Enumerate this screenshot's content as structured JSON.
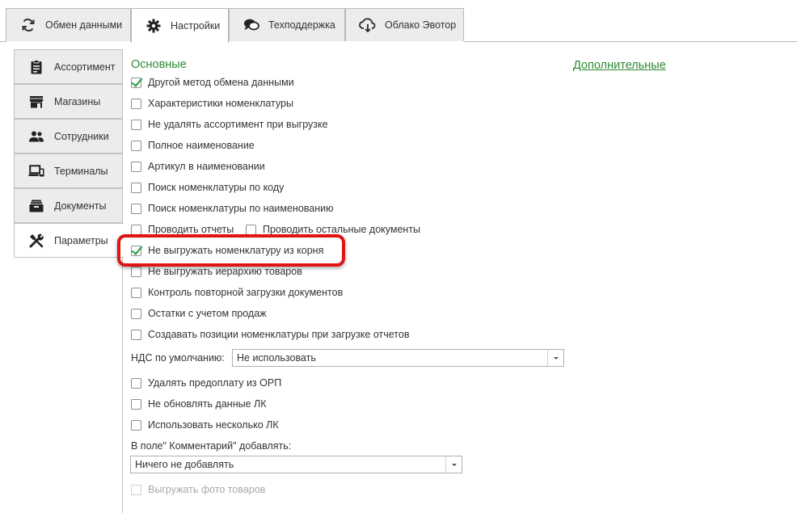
{
  "top_tabs": [
    {
      "label": "Обмен данными",
      "icon": "sync-icon"
    },
    {
      "label": "Настройки",
      "icon": "gear-icon"
    },
    {
      "label": "Техподдержка",
      "icon": "chat-icon"
    },
    {
      "label": "Облако Эвотор",
      "icon": "cloud-icon"
    }
  ],
  "side_tabs": [
    {
      "label": "Ассортимент",
      "icon": "clipboard-icon"
    },
    {
      "label": "Магазины",
      "icon": "store-icon"
    },
    {
      "label": "Сотрудники",
      "icon": "people-icon"
    },
    {
      "label": "Терминалы",
      "icon": "devices-icon"
    },
    {
      "label": "Документы",
      "icon": "archive-icon"
    },
    {
      "label": "Параметры",
      "icon": "tools-icon"
    }
  ],
  "sections": {
    "main": "Основные",
    "additional": "Дополнительные"
  },
  "options": [
    {
      "label": "Другой метод обмена данными",
      "checked": true
    },
    {
      "label": "Характеристики номенклатуры",
      "checked": false
    },
    {
      "label": "Не удалять ассортимент при выгрузке",
      "checked": false
    },
    {
      "label": "Полное наименование",
      "checked": false
    },
    {
      "label": "Артикул в наименовании",
      "checked": false
    },
    {
      "label": "Поиск номенклатуры по коду",
      "checked": false
    },
    {
      "label": "Поиск номенклатуры по наименованию",
      "checked": false
    },
    {
      "label": "Проводить отчеты",
      "checked": false
    },
    {
      "label": "Проводить остальные документы",
      "checked": false
    },
    {
      "label": "Не выгружать номенклатуру из корня",
      "checked": true
    },
    {
      "label": "Не выгружать иерархию товаров",
      "checked": false
    },
    {
      "label": "Контроль повторной загрузки документов",
      "checked": false
    },
    {
      "label": "Остатки с учетом продаж",
      "checked": false
    },
    {
      "label": "Создавать позиции номенклатуры при загрузке отчетов",
      "checked": false
    }
  ],
  "vat": {
    "label": "НДС по умолчанию:",
    "value": "Не использовать"
  },
  "options2": [
    {
      "label": "Удалять предоплату из ОРП",
      "checked": false
    },
    {
      "label": "Не обновлять данные ЛК",
      "checked": false
    },
    {
      "label": "Использовать несколько ЛК",
      "checked": false
    }
  ],
  "comment": {
    "label": "В поле\" Комментарий\" добавлять:",
    "value": "Ничего не добавлять"
  },
  "photo_option": {
    "label": "Выгружать фото товаров",
    "checked": false,
    "disabled": true
  }
}
